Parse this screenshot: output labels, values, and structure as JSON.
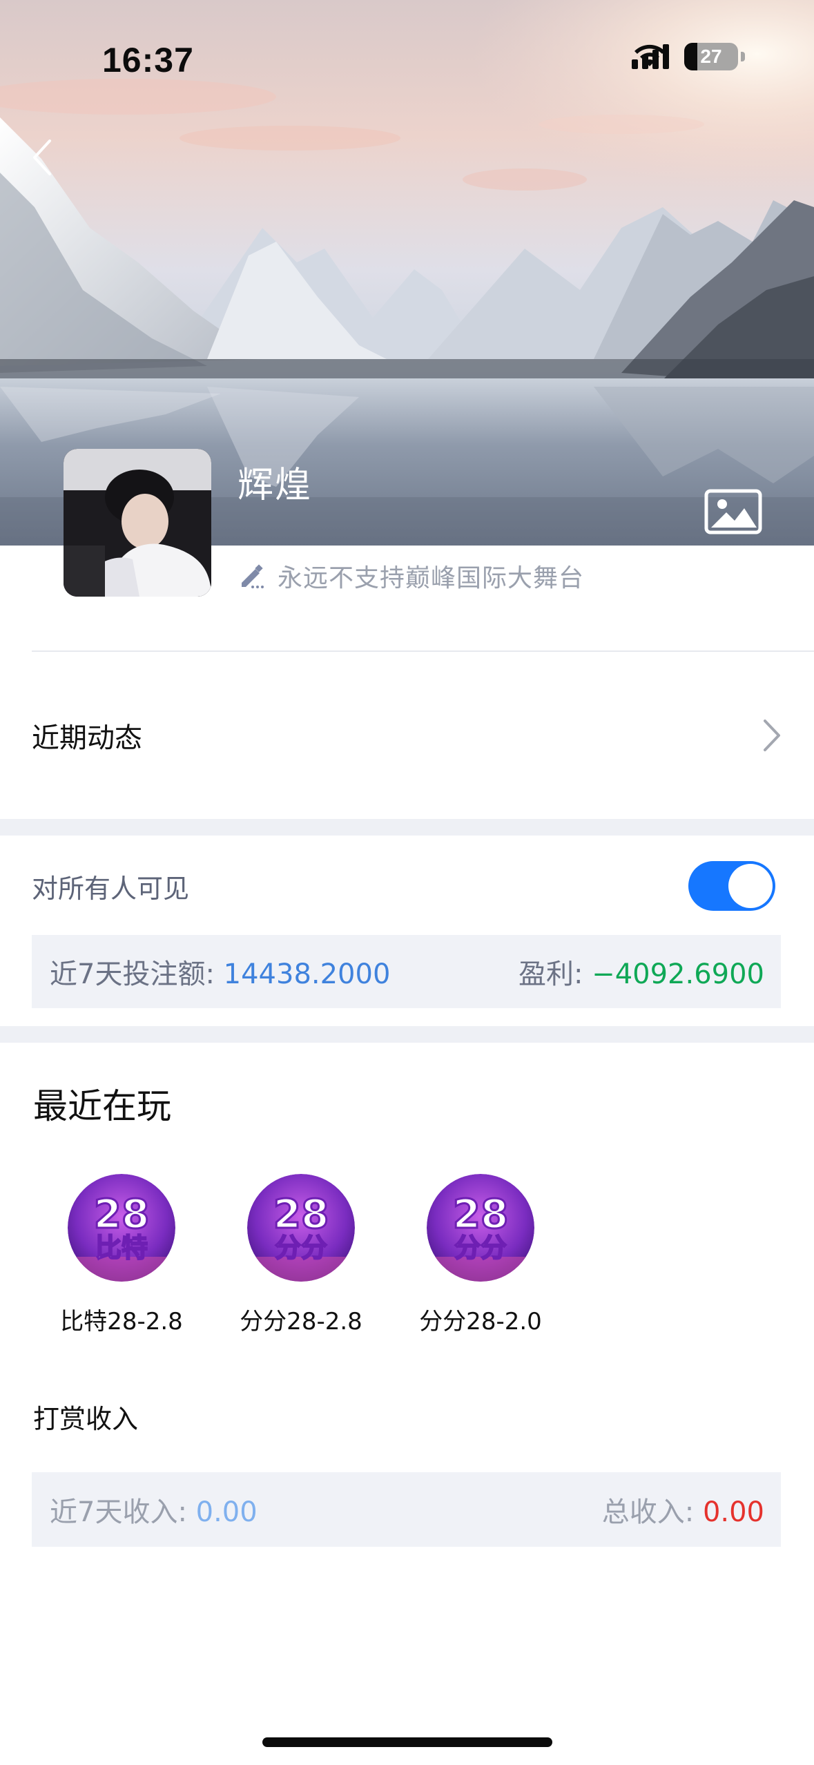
{
  "status_bar": {
    "time": "16:37",
    "battery": "27"
  },
  "profile": {
    "name": "辉煌",
    "signature": "永远不支持巅峰国际大舞台"
  },
  "recent_activity": {
    "label": "近期动态"
  },
  "visibility": {
    "label": "对所有人可见",
    "enabled": true
  },
  "bet_stats": {
    "bet_label": "近7天投注额: ",
    "bet_value": "14438.2000",
    "profit_label": "盈利: ",
    "profit_value": "−4092.6900"
  },
  "recently_playing": {
    "title": "最近在玩",
    "games": [
      {
        "name": "比特28-2.8",
        "icon_text_top": "28",
        "icon_text_bottom": "比特"
      },
      {
        "name": "分分28-2.8",
        "icon_text_top": "28",
        "icon_text_bottom": "分分"
      },
      {
        "name": "分分28-2.0",
        "icon_text_top": "28",
        "icon_text_bottom": "分分"
      }
    ]
  },
  "tip_income": {
    "title": "打赏收入",
    "week_label": "近7天收入: ",
    "week_value": "0.00",
    "total_label": "总收入: ",
    "total_value": "0.00"
  },
  "colors": {
    "accent": "#1677ff",
    "value_blue": "#3f82dd",
    "profit_green": "#0fa856",
    "total_red": "#e5322d",
    "panel_bg": "#f0f2f7"
  },
  "icons": [
    "back-chevron-icon",
    "image-icon",
    "edit-pencil-icon",
    "chevron-right-icon"
  ]
}
